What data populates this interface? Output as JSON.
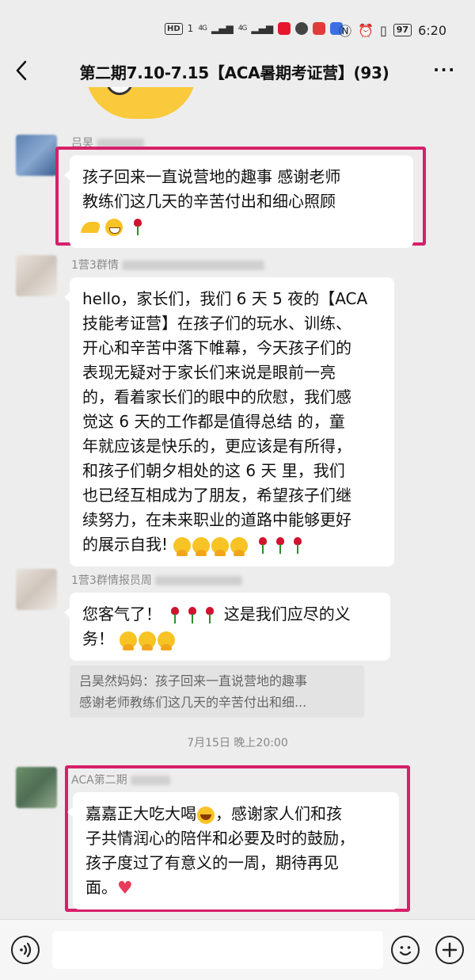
{
  "status_bar": {
    "hd": "HD",
    "sim1": "1",
    "sig1": "4G",
    "sig2": "4G",
    "battery": "97",
    "time": "6:20"
  },
  "header": {
    "title": "第二期7.10-7.15【ACA暑期考证营】(93)"
  },
  "messages": [
    {
      "sender": "吕昊",
      "text_lines": [
        "孩子回来一直说营地的趣事 感谢老师",
        "教练们这几天的辛苦付出和细心照顾"
      ]
    },
    {
      "sender": "1营3群情",
      "text_lines": [
        "hello，家长们，我们 6 天 5 夜的【ACA",
        "技能考证营】在孩子们的玩水、训练、",
        "开心和辛苦中落下帷幕，今天孩子们的",
        "表现无疑对于家长们来说是眼前一亮",
        "的，看着家长们的眼中的欣慰，我们感",
        "觉这 6 天的工作都是值得总结 的，童",
        "年就应该是快乐的，更应该是有所得，",
        "和孩子们朝夕相处的这 6 天 里，我们",
        "也已经互相成为了朋友，希望孩子们继",
        "续努力，在未来职业的道路中能够更好",
        "的展示自我!"
      ]
    },
    {
      "sender": "1营3群情报员周",
      "text_line1": "您客气了！",
      "text_line1b": "这是我们应尽的义",
      "text_line2": "务！"
    }
  ],
  "quote": {
    "line1": "吕昊然妈妈：孩子回来一直说营地的趣事",
    "line2": "感谢老师教练们这几天的辛苦付出和细..."
  },
  "timestamp": "7月15日 晚上20:00",
  "last_message": {
    "sender": "ACA第二期",
    "line1": "嘉嘉正大吃大喝",
    "line1b": "，感谢家人们和孩",
    "line2": "子共情润心的陪伴和必要及时的鼓励，",
    "line3": "孩子度过了有意义的一周，期待再见",
    "line4": "面。"
  },
  "colors": {
    "highlight": "#d6206a",
    "bubble": "#ffffff",
    "background": "#ededed"
  },
  "icons": [
    "back-icon",
    "more-icon",
    "voice-icon",
    "emoji-icon",
    "plus-icon"
  ]
}
